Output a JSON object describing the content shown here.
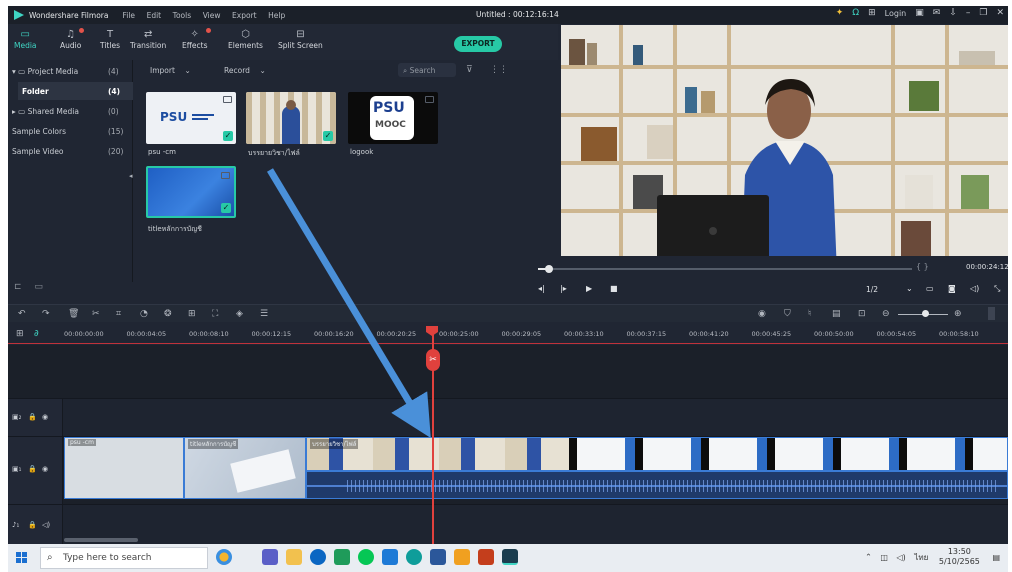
{
  "app": {
    "name": "Wondershare Filmora",
    "menu": [
      "File",
      "Edit",
      "Tools",
      "View",
      "Export",
      "Help"
    ],
    "project_title": "Untitled : 00:12:16:14",
    "login": "Login"
  },
  "toolbar": {
    "items": [
      "Media",
      "Audio",
      "Titles",
      "Transition",
      "Effects",
      "Elements",
      "Split Screen"
    ],
    "export_label": "EXPORT"
  },
  "library": {
    "rows": [
      {
        "label": "Project Media",
        "count": "(4)"
      },
      {
        "label": "Folder",
        "count": "(4)"
      },
      {
        "label": "Shared Media",
        "count": "(0)"
      },
      {
        "label": "Sample Colors",
        "count": "(15)"
      },
      {
        "label": "Sample Video",
        "count": "(20)"
      }
    ]
  },
  "media": {
    "import_label": "Import",
    "record_label": "Record",
    "search_placeholder": "Search",
    "items": [
      {
        "caption": "psu -cm",
        "logo": "PSU"
      },
      {
        "caption": "บรรยายวิชา/ไฟล์",
        "logo": ""
      },
      {
        "caption": "logook",
        "logo": "PSU"
      },
      {
        "caption": "titleหลักการบัญชี",
        "logo": ""
      }
    ],
    "psu_sub": "MOOC"
  },
  "preview": {
    "timecode": "00:00:24:12",
    "ratio": "1/2",
    "brackets": "{    }",
    "progress": 0.03
  },
  "timeline": {
    "ticks": [
      "00:00:00:00",
      "00:00:04:05",
      "00:00:08:10",
      "00:00:12:15",
      "00:00:16:20",
      "00:00:20:25",
      "00:00:25:00",
      "00:00:29:05",
      "00:00:33:10",
      "00:00:37:15",
      "00:00:41:20",
      "00:00:45:25",
      "00:00:50:00",
      "00:00:54:05",
      "00:00:58:10"
    ],
    "clips": [
      {
        "name": "psu -cm"
      },
      {
        "name": "titleหลักการบัญชี"
      },
      {
        "name": "บรรยายวิชา/ไฟล์"
      }
    ]
  },
  "taskbar": {
    "search_placeholder": "Type here to search",
    "time": "13:50",
    "date": "5/10/2565",
    "lang": "ไทย"
  },
  "colors": {
    "accent": "#27c9a6",
    "playhead": "#e0413d",
    "arrow": "#4a90d9",
    "panel": "#202633"
  }
}
